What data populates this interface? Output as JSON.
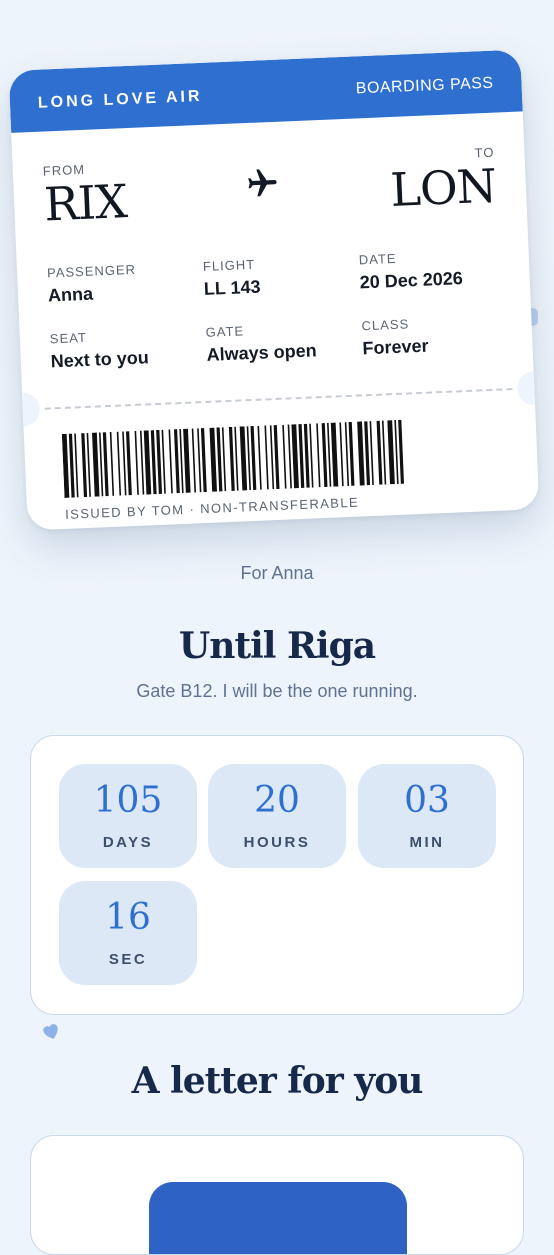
{
  "pass": {
    "airline": "LONG LOVE AIR",
    "type": "BOARDING PASS",
    "from_label": "FROM",
    "from_code": "RIX",
    "to_label": "TO",
    "to_code": "LON",
    "plane_icon": "airplane-icon",
    "fields": [
      {
        "label": "PASSENGER",
        "value": "Anna"
      },
      {
        "label": "FLIGHT",
        "value": "LL 143"
      },
      {
        "label": "DATE",
        "value": "20 Dec 2026"
      },
      {
        "label": "SEAT",
        "value": "Next to you"
      },
      {
        "label": "GATE",
        "value": "Always open"
      },
      {
        "label": "CLASS",
        "value": "Forever"
      }
    ],
    "issued": "ISSUED BY TOM · NON-TRANSFERABLE"
  },
  "dedication": "For Anna",
  "countdown": {
    "title": "Until Riga",
    "subtitle": "Gate B12. I will be the one running.",
    "tiles": [
      {
        "value": "105",
        "unit": "DAYS"
      },
      {
        "value": "20",
        "unit": "HOURS"
      },
      {
        "value": "03",
        "unit": "MIN"
      },
      {
        "value": "16",
        "unit": "SEC"
      }
    ]
  },
  "letter": {
    "title": "A letter for you"
  },
  "colors": {
    "accent": "#2e6fd0",
    "background": "#eef4fb",
    "tile": "#dce8f6",
    "heading": "#17294a"
  }
}
